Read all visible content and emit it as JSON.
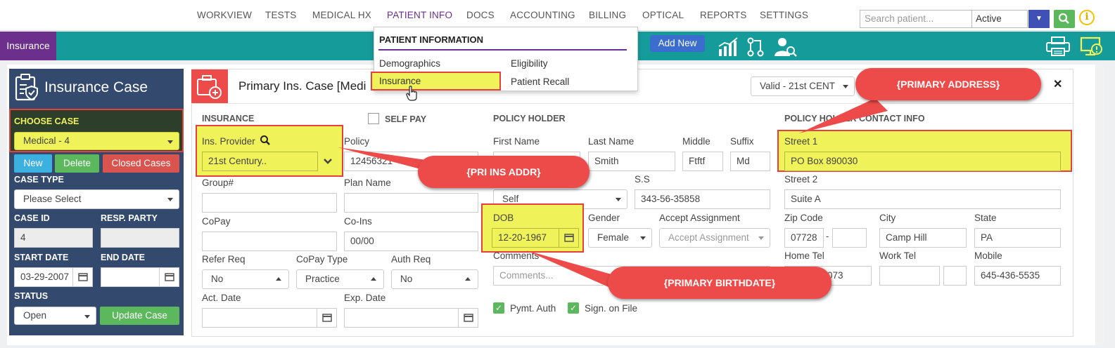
{
  "nav": {
    "items": [
      "WORKVIEW",
      "TESTS",
      "MEDICAL HX",
      "PATIENT INFO",
      "DOCS",
      "ACCOUNTING",
      "BILLING",
      "OPTICAL",
      "REPORTS",
      "SETTINGS"
    ],
    "search_placeholder": "Search patient...",
    "status": "Active"
  },
  "toolbar": {
    "tab": "Insurance",
    "add_new": "Add New"
  },
  "dropdown": {
    "heading": "PATIENT INFORMATION",
    "items": [
      "Demographics",
      "Eligibility",
      "Insurance",
      "Patient Recall"
    ]
  },
  "left": {
    "title": "Insurance Case",
    "choose_case": "CHOOSE CASE",
    "case_value": "Medical - 4",
    "new": "New",
    "delete": "Delete",
    "closed": "Closed Cases",
    "case_type_label": "CASE TYPE",
    "case_type_value": "Please Select",
    "case_id_label": "CASE ID",
    "resp_party_label": "RESP. PARTY",
    "case_id_value": "4",
    "resp_party_value": "",
    "start_label": "START DATE",
    "end_label": "END DATE",
    "start_value": "03-29-2007",
    "end_value": "",
    "status_label": "STATUS",
    "status_value": "Open",
    "update": "Update Case"
  },
  "panel": {
    "title": "Primary Ins. Case [Medi",
    "valid": "Valid - 21st CENT",
    "close": "✕"
  },
  "insurance": {
    "heading": "INSURANCE",
    "self_pay": "SELF PAY",
    "provider_label": "Ins. Provider",
    "provider_value": "21st Century..",
    "policy_label": "Policy",
    "policy_value": "12456321",
    "group_label": "Group#",
    "plan_label": "Plan Name",
    "copay_label": "CoPay",
    "coins_label": "Co-Ins",
    "coins_value": "00/00",
    "refer_label": "Refer Req",
    "refer_value": "No",
    "copay_type_label": "CoPay Type",
    "copay_type_value": "Practice",
    "auth_label": "Auth Req",
    "auth_value": "No",
    "act_label": "Act. Date",
    "exp_label": "Exp. Date"
  },
  "holder": {
    "heading": "POLICY HOLDER",
    "first_label": "First Name",
    "last_label": "Last Name",
    "middle_label": "Middle",
    "suffix_label": "Suffix",
    "last_value": "Smith",
    "middle_value": "Ftftf",
    "suffix_value": "Md",
    "relation_value": "Self",
    "ss_label": "S.S",
    "ss_value": "343-56-35858",
    "dob_label": "DOB",
    "dob_value": "12-20-1967",
    "gender_label": "Gender",
    "gender_value": "Female",
    "accept_label": "Accept Assignment",
    "accept_value": "Accept Assignment",
    "comments_label": "Comments",
    "comments_placeholder": "Comments...",
    "pymt": "Pymt. Auth",
    "sign": "Sign. on File"
  },
  "contact": {
    "heading": "POLICY HOLDER CONTACT INFO",
    "street1_label": "Street 1",
    "street1_value": "PO Box 890030",
    "street2_label": "Street 2",
    "street2_value": "Suite A",
    "zip_label": "Zip Code",
    "zip_value": "07728",
    "city_label": "City",
    "city_value": "Camp Hill",
    "state_label": "State",
    "state_value": "PA",
    "home_label": "Home Tel",
    "home_value": "073",
    "work_label": "Work Tel",
    "mobile_label": "Mobile",
    "mobile_value": "645-436-5535"
  },
  "callouts": {
    "address": "{PRIMARY ADDRESS}",
    "ins_addr": "{PRI INS ADDR}",
    "birthdate": "{PRIMARY BIRTHDATE}"
  },
  "colors": {
    "purple": "#6c2f8c",
    "teal": "#169b9b",
    "navy": "#33496e",
    "red": "#ec4b49",
    "highlight": "#f0f25a",
    "green": "#5cb85c"
  }
}
